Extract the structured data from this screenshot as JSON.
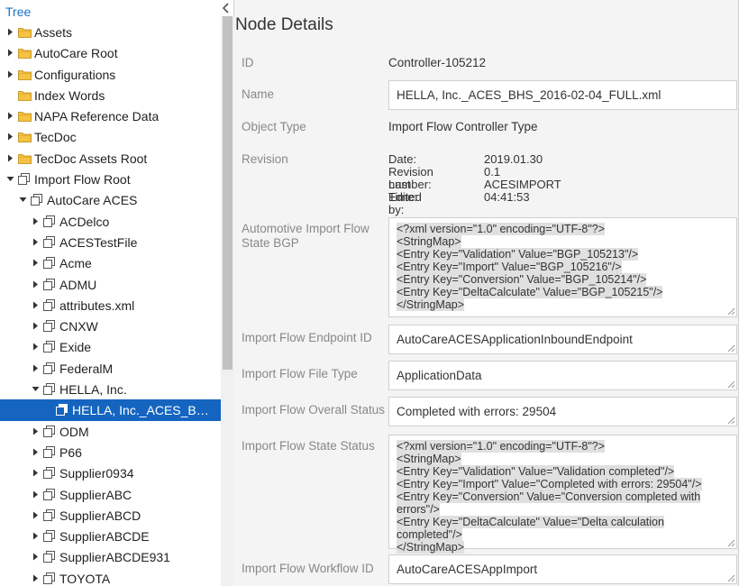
{
  "tree": {
    "title": "Tree",
    "items": [
      {
        "label": "Assets",
        "level": 0,
        "twisty": "right",
        "icon": "folder-icon"
      },
      {
        "label": "AutoCare Root",
        "level": 0,
        "twisty": "right",
        "icon": "folder-icon"
      },
      {
        "label": "Configurations",
        "level": 0,
        "twisty": "right",
        "icon": "folder-icon"
      },
      {
        "label": "Index Words",
        "level": 0,
        "twisty": "none",
        "icon": "folder-icon"
      },
      {
        "label": "NAPA Reference Data",
        "level": 0,
        "twisty": "right",
        "icon": "folder-icon"
      },
      {
        "label": "TecDoc",
        "level": 0,
        "twisty": "right",
        "icon": "folder-icon"
      },
      {
        "label": "TecDoc Assets Root",
        "level": 0,
        "twisty": "right",
        "icon": "folder-icon"
      },
      {
        "label": "Import Flow Root",
        "level": 0,
        "twisty": "down",
        "icon": "node-icon"
      },
      {
        "label": "AutoCare ACES",
        "level": 1,
        "twisty": "down",
        "icon": "node-icon"
      },
      {
        "label": "ACDelco",
        "level": 2,
        "twisty": "right",
        "icon": "node-icon"
      },
      {
        "label": "ACESTestFile",
        "level": 2,
        "twisty": "right",
        "icon": "node-icon"
      },
      {
        "label": "Acme",
        "level": 2,
        "twisty": "right",
        "icon": "node-icon"
      },
      {
        "label": "ADMU",
        "level": 2,
        "twisty": "right",
        "icon": "node-icon"
      },
      {
        "label": "attributes.xml",
        "level": 2,
        "twisty": "right",
        "icon": "node-icon"
      },
      {
        "label": "CNXW",
        "level": 2,
        "twisty": "right",
        "icon": "node-icon"
      },
      {
        "label": "Exide",
        "level": 2,
        "twisty": "right",
        "icon": "node-icon"
      },
      {
        "label": "FederalM",
        "level": 2,
        "twisty": "right",
        "icon": "node-icon"
      },
      {
        "label": "HELLA, Inc.",
        "level": 2,
        "twisty": "down",
        "icon": "node-icon"
      },
      {
        "label": "HELLA, Inc._ACES_BHS_...",
        "level": 3,
        "twisty": "none",
        "icon": "leaf-icon",
        "selected": true
      },
      {
        "label": "ODM",
        "level": 2,
        "twisty": "right",
        "icon": "node-icon"
      },
      {
        "label": "P66",
        "level": 2,
        "twisty": "right",
        "icon": "node-icon"
      },
      {
        "label": "Supplier0934",
        "level": 2,
        "twisty": "right",
        "icon": "node-icon"
      },
      {
        "label": "SupplierABC",
        "level": 2,
        "twisty": "right",
        "icon": "node-icon"
      },
      {
        "label": "SupplierABCD",
        "level": 2,
        "twisty": "right",
        "icon": "node-icon"
      },
      {
        "label": "SupplierABCDE",
        "level": 2,
        "twisty": "right",
        "icon": "node-icon"
      },
      {
        "label": "SupplierABCDE931",
        "level": 2,
        "twisty": "right",
        "icon": "node-icon"
      },
      {
        "label": "TOYOTA",
        "level": 2,
        "twisty": "right",
        "icon": "node-icon"
      }
    ]
  },
  "details": {
    "title": "Node Details",
    "id": {
      "label": "ID",
      "value": "Controller-105212"
    },
    "name": {
      "label": "Name",
      "value": "HELLA, Inc._ACES_BHS_2016-02-04_FULL.xml"
    },
    "object_type": {
      "label": "Object Type",
      "value": "Import Flow Controller Type"
    },
    "revision": {
      "label": "Revision",
      "rows": [
        {
          "key": "Date:",
          "value": "2019.01.30"
        },
        {
          "key": "Revision number:",
          "value": "0.1"
        },
        {
          "key": "Last Edited by:",
          "value": "ACESIMPORT"
        },
        {
          "key": "Time:",
          "value": "04:41:53"
        }
      ]
    },
    "state_bgp": {
      "label": "Automotive Import Flow State BGP",
      "lines": [
        "<?xml version=\"1.0\" encoding=\"UTF-8\"?>",
        "<StringMap>",
        "<Entry Key=\"Validation\" Value=\"BGP_105213\"/>",
        "<Entry Key=\"Import\" Value=\"BGP_105216\"/>",
        "<Entry Key=\"Conversion\" Value=\"BGP_105214\"/>",
        "<Entry Key=\"DeltaCalculate\" Value=\"BGP_105215\"/>",
        "</StringMap>"
      ]
    },
    "endpoint": {
      "label": "Import Flow Endpoint ID",
      "value": "AutoCareACESApplicationInboundEndpoint"
    },
    "file_type": {
      "label": "Import Flow File Type",
      "value": "ApplicationData"
    },
    "overall_status": {
      "label": "Import Flow Overall Status",
      "value": "Completed with errors: 29504"
    },
    "state_status": {
      "label": "Import Flow State Status",
      "lines": [
        "<?xml version=\"1.0\" encoding=\"UTF-8\"?>",
        "<StringMap>",
        "<Entry Key=\"Validation\" Value=\"Validation completed\"/>",
        "<Entry Key=\"Import\" Value=\"Completed with errors: 29504\"/>",
        "<Entry Key=\"Conversion\" Value=\"Conversion completed with",
        "errors\"/>",
        "<Entry Key=\"DeltaCalculate\" Value=\"Delta calculation completed\"/>",
        "</StringMap>"
      ]
    },
    "workflow": {
      "label": "Import Flow Workflow ID",
      "value": "AutoCareACESAppImport"
    }
  },
  "colors": {
    "selection": "#1565c0",
    "link": "#1a73c9",
    "folder": "#f5c242"
  }
}
